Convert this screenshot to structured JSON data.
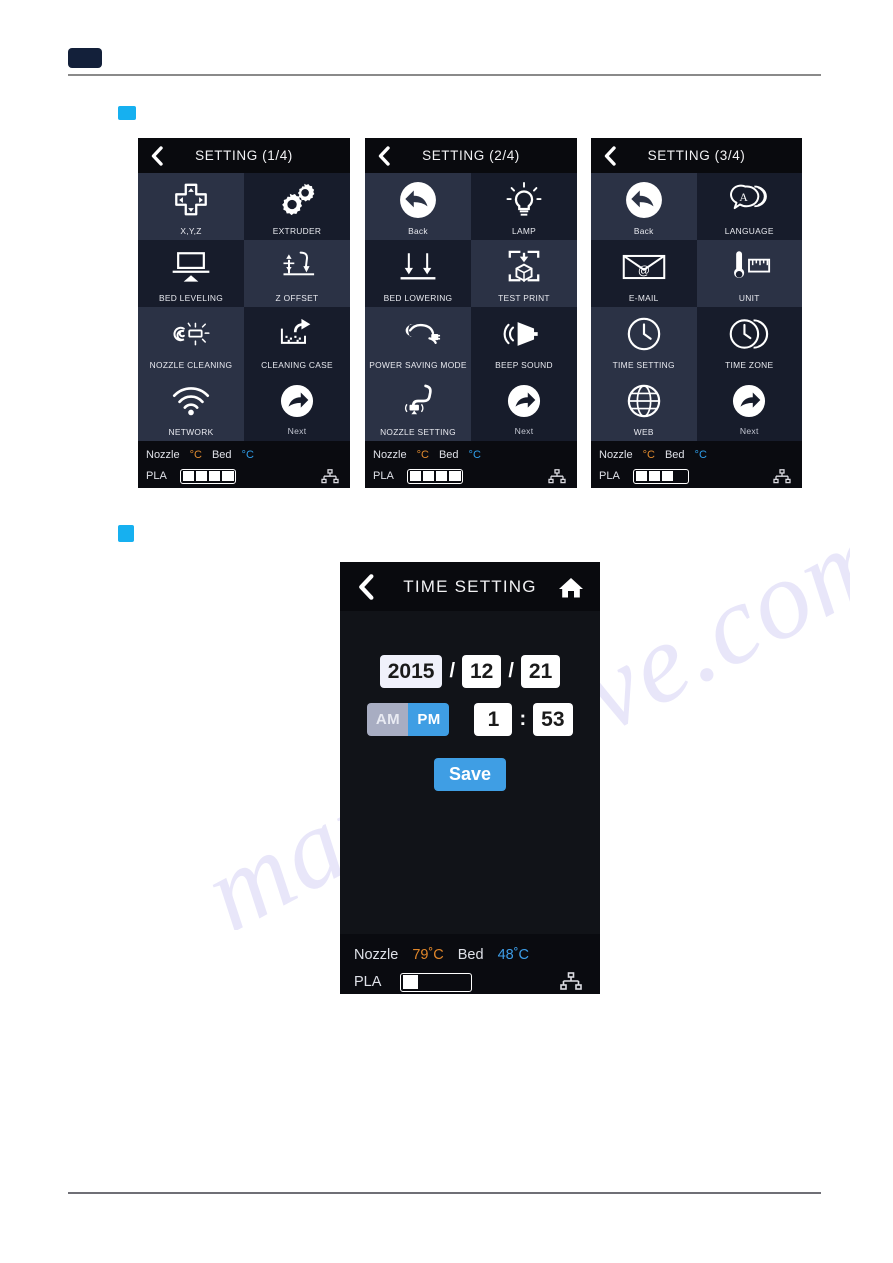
{
  "document": {
    "header_chip": "",
    "section_markers": 2
  },
  "watermark": {
    "text": "manualsive.com"
  },
  "screens": [
    {
      "id": "setting-1-4",
      "title": "SETTING (1/4)",
      "back_icon": "chevron-left-icon",
      "tiles": [
        {
          "label": "X,Y,Z",
          "icon": "dpad-icon",
          "shade": "light"
        },
        {
          "label": "EXTRUDER",
          "icon": "gears-icon",
          "shade": "dark"
        },
        {
          "label": "BED LEVELING",
          "icon": "bed-leveling-icon",
          "shade": "light"
        },
        {
          "label": "Z OFFSET",
          "icon": "z-offset-icon",
          "shade": "dark"
        },
        {
          "label": "NOZZLE CLEANING",
          "icon": "nozzle-cleaning-icon",
          "shade": "light"
        },
        {
          "label": "CLEANING CASE",
          "icon": "cleaning-case-icon",
          "shade": "dark"
        },
        {
          "label": "NETWORK",
          "icon": "wifi-icon",
          "shade": "light"
        },
        {
          "label": "Next",
          "icon": "next-arrow-icon",
          "shade": "dark"
        }
      ],
      "status": {
        "nozzle_label": "Nozzle",
        "nozzle_value": "°C",
        "bed_label": "Bed",
        "bed_value": "°C",
        "material": "PLA",
        "filament_segments": 4,
        "filament_filled": 4,
        "network_icon": "ethernet-icon"
      }
    },
    {
      "id": "setting-2-4",
      "title": "SETTING (2/4)",
      "back_icon": "chevron-left-icon",
      "tiles": [
        {
          "label": "Back",
          "icon": "back-arrow-icon",
          "shade": "light"
        },
        {
          "label": "LAMP",
          "icon": "lamp-icon",
          "shade": "dark"
        },
        {
          "label": "BED LOWERING",
          "icon": "bed-lowering-icon",
          "shade": "light"
        },
        {
          "label": "TEST PRINT",
          "icon": "test-print-icon",
          "shade": "dark"
        },
        {
          "label": "POWER SAVING MODE",
          "icon": "power-plug-icon",
          "shade": "light"
        },
        {
          "label": "BEEP SOUND",
          "icon": "speaker-icon",
          "shade": "dark"
        },
        {
          "label": "NOZZLE SETTING",
          "icon": "nozzle-setting-icon",
          "shade": "light"
        },
        {
          "label": "Next",
          "icon": "next-arrow-icon",
          "shade": "dark"
        }
      ],
      "status": {
        "nozzle_label": "Nozzle",
        "nozzle_value": "°C",
        "bed_label": "Bed",
        "bed_value": "°C",
        "material": "PLA",
        "filament_segments": 4,
        "filament_filled": 4,
        "network_icon": "ethernet-icon"
      }
    },
    {
      "id": "setting-3-4",
      "title": "SETTING (3/4)",
      "back_icon": "chevron-left-icon",
      "tiles": [
        {
          "label": "Back",
          "icon": "back-arrow-icon",
          "shade": "light"
        },
        {
          "label": "LANGUAGE",
          "icon": "language-icon",
          "shade": "dark"
        },
        {
          "label": "E-MAIL",
          "icon": "email-icon",
          "shade": "light"
        },
        {
          "label": "UNIT",
          "icon": "unit-icon",
          "shade": "dark"
        },
        {
          "label": "TIME SETTING",
          "icon": "clock-icon",
          "shade": "light"
        },
        {
          "label": "TIME ZONE",
          "icon": "time-zone-icon",
          "shade": "dark"
        },
        {
          "label": "WEB",
          "icon": "globe-icon",
          "shade": "light"
        },
        {
          "label": "Next",
          "icon": "next-arrow-icon",
          "shade": "dark"
        }
      ],
      "status": {
        "nozzle_label": "Nozzle",
        "nozzle_value": "°C",
        "bed_label": "Bed",
        "bed_value": "°C",
        "material": "PLA",
        "filament_segments": 4,
        "filament_filled": 3,
        "network_icon": "ethernet-icon"
      }
    }
  ],
  "time_setting": {
    "title": "TIME SETTING",
    "back_icon": "chevron-left-icon",
    "home_icon": "home-icon",
    "year": "2015",
    "date_sep_1": "/",
    "month": "12",
    "date_sep_2": "/",
    "day": "21",
    "am_label": "AM",
    "pm_label": "PM",
    "meridiem_selected": "PM",
    "hour": "1",
    "time_sep": ":",
    "minute": "53",
    "save_label": "Save",
    "status": {
      "nozzle_label": "Nozzle",
      "nozzle_value": "79˚C",
      "bed_label": "Bed",
      "bed_value": "48˚C",
      "material": "PLA",
      "filament_segments": 4,
      "filament_filled": 1,
      "network_icon": "ethernet-icon"
    }
  },
  "colors": {
    "accent_blue": "#16b0f0",
    "button_blue": "#3f9ee4",
    "tile_light": "#2b3245",
    "tile_dark": "#171c2b",
    "nozzle_temp": "#e08a2e",
    "bed_temp": "#2f9eea"
  }
}
